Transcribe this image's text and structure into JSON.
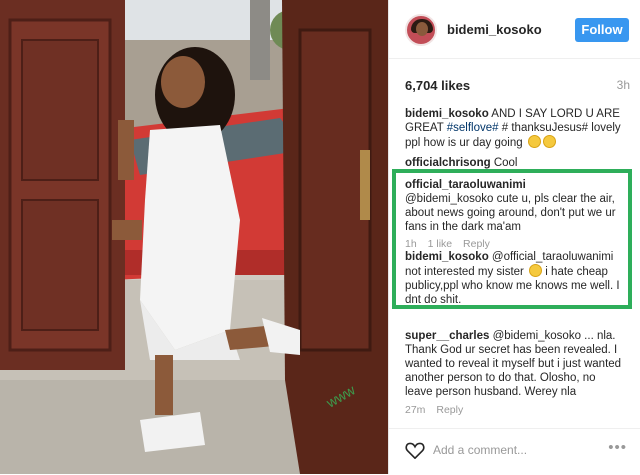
{
  "post": {
    "username": "bidemi_kosoko",
    "follow_label": "Follow",
    "likes": "6,704 likes",
    "time": "3h",
    "caption": {
      "user": "bidemi_kosoko",
      "text_before": "AND I SAY LORD U ARE GREAT",
      "tag1": "#selflove#",
      "text_mid": "# thanksuJesus#",
      "text_after": "lovely ppl how is ur day going"
    }
  },
  "comments": [
    {
      "user": "officialchrisong",
      "text": "Cool"
    },
    {
      "user": "official_taraoluwanimi",
      "text": "@bidemi_kosoko cute u, pls clear the air, about news going around, don't put we ur fans in the dark ma'am",
      "age": "1h",
      "likes": "1 like",
      "reply": "Reply"
    },
    {
      "user": "bidemi_kosoko",
      "text": "@official_taraoluwanimi not interested my sister",
      "text2": "i hate cheap publicy,ppl who know me knows me well. I dnt do shit."
    },
    {
      "user": "super__charles",
      "text": "@bidemi_kosoko ... nla. Thank God ur secret has been revealed. I wanted to reveal it myself but i just wanted another person to do that. Olosho, no leave person husband. Werey nla",
      "age": "27m",
      "reply": "Reply"
    }
  ],
  "add_comment_placeholder": "Add a comment...",
  "icons": {
    "heart": "heart-icon",
    "more": "more-options-icon"
  },
  "colors": {
    "follow": "#3897f0",
    "highlight": "#2eae5a",
    "link": "#003569"
  }
}
